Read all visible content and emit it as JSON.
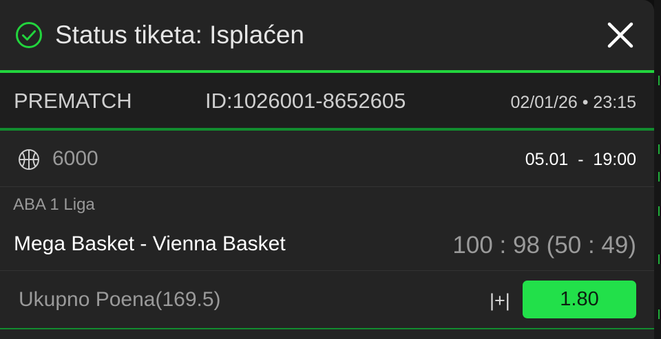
{
  "header": {
    "title": "Status tiketa: Isplaćen",
    "status_icon": "check-circle-icon",
    "close_icon": "close-icon",
    "accent_color": "#22d43d"
  },
  "ticket": {
    "type": "PREMATCH",
    "id": "ID:1026001-8652605",
    "datetime": "02/01/26 • 23:15"
  },
  "event": {
    "sport_icon": "basketball-icon",
    "code": "6000",
    "start_time": "05.01  -  19:00",
    "league": "ABA 1 Liga",
    "match": "Mega Basket - Vienna Basket",
    "score": "100 : 98 (50 : 49)"
  },
  "bet": {
    "market": "Ukupno Poena(169.5)",
    "pick": "|+|",
    "odds": "1.80",
    "odds_color": "#22e04a"
  }
}
